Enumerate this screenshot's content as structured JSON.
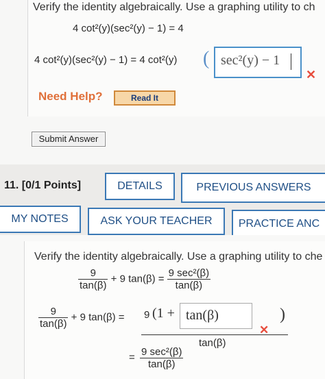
{
  "q10": {
    "prompt": "Verify the identity algebraically. Use a graphing utility to ch",
    "identity": "4 cot²(y)(sec²(y) − 1) = 4",
    "lhs": "4 cot²(y)(sec²(y) − 1) = 4 cot²(y)",
    "open_paren": "(",
    "answer_value": "sec²(y) − 1",
    "wrong_mark": "✕",
    "need_help": "Need Help?",
    "read_it": "Read It",
    "submit": "Submit Answer"
  },
  "q11": {
    "label": "11.  [0/1 Points]",
    "buttons": {
      "details": "DETAILS",
      "previous": "PREVIOUS ANSWERS",
      "my_notes": "MY NOTES",
      "ask": "ASK YOUR TEACHER",
      "practice": "PRACTICE ANC"
    },
    "prompt": "Verify the identity algebraically. Use a graphing utility to che",
    "identity": {
      "num1": "9",
      "den1": "tan(β)",
      "plus": "+ 9 tan(β) =",
      "num2": "9 sec²(β)",
      "den2": "tan(β)"
    },
    "step": {
      "num1": "9",
      "den1": "tan(β)",
      "plus": "+ 9 tan(β) =",
      "num_prefix": "9",
      "num_open": "(1 +",
      "answer_value": "tan(β)",
      "num_close": ")",
      "den": "tan(β)",
      "wrong_mark": "✕"
    },
    "result": {
      "eq": "=",
      "num": "9 sec²(β)",
      "den": "tan(β)"
    }
  },
  "colors": {
    "accent_blue": "#3a78b5",
    "wrong_red": "#e74c3c",
    "help_orange": "#e0703a"
  }
}
